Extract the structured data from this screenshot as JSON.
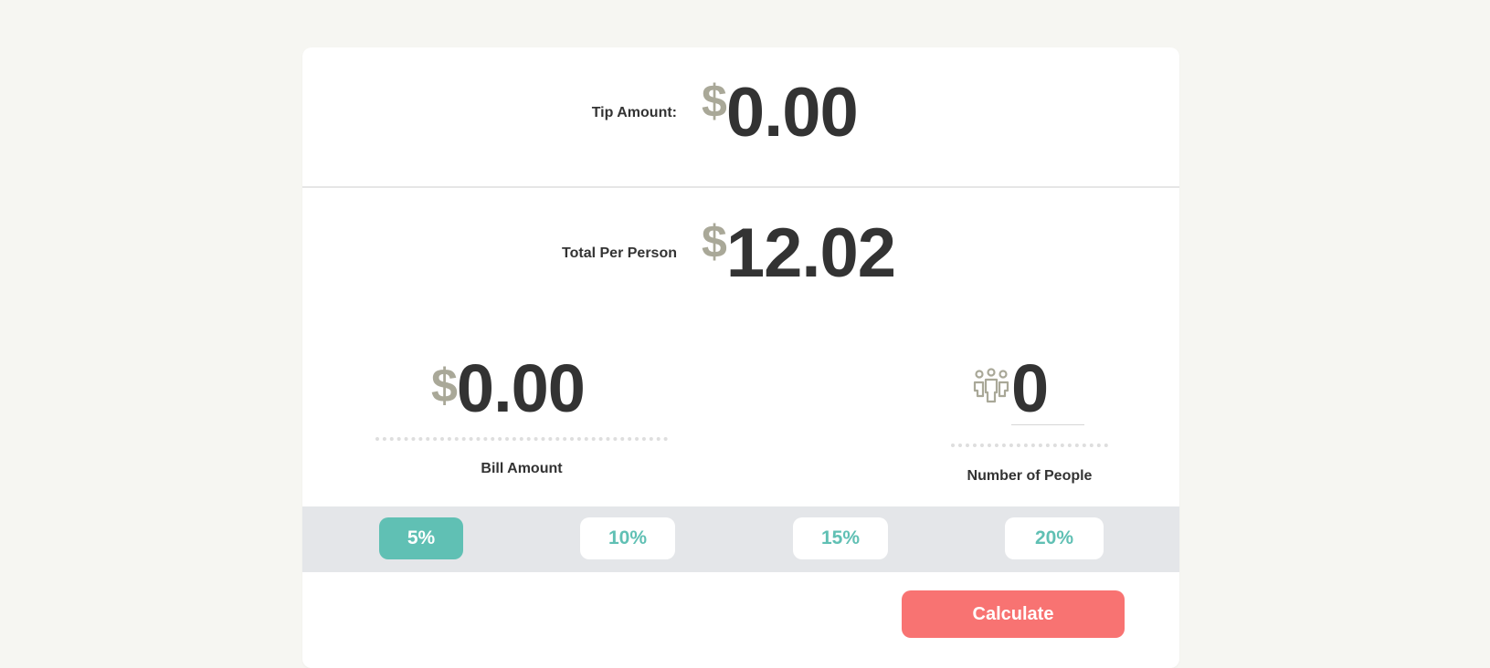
{
  "tip_amount": {
    "label": "Tip Amount:",
    "currency": "$",
    "value": "0.00"
  },
  "total_per_person": {
    "label": "Total Per Person",
    "currency": "$",
    "value": "12.02"
  },
  "bill": {
    "currency": "$",
    "value": "0.00",
    "label": "Bill Amount"
  },
  "people": {
    "icon": "people-group-icon",
    "value": "0",
    "label": "Number of People"
  },
  "tips": [
    {
      "label": "5%",
      "active": true
    },
    {
      "label": "10%",
      "active": false
    },
    {
      "label": "15%",
      "active": false
    },
    {
      "label": "20%",
      "active": false
    }
  ],
  "calculate_label": "Calculate",
  "colors": {
    "accent": "#60c0b4",
    "calculate": "#f87372",
    "currency": "#a9a898",
    "text": "#333333",
    "tip_bar": "#e4e6e9",
    "page_bg": "#f6f6f2"
  }
}
